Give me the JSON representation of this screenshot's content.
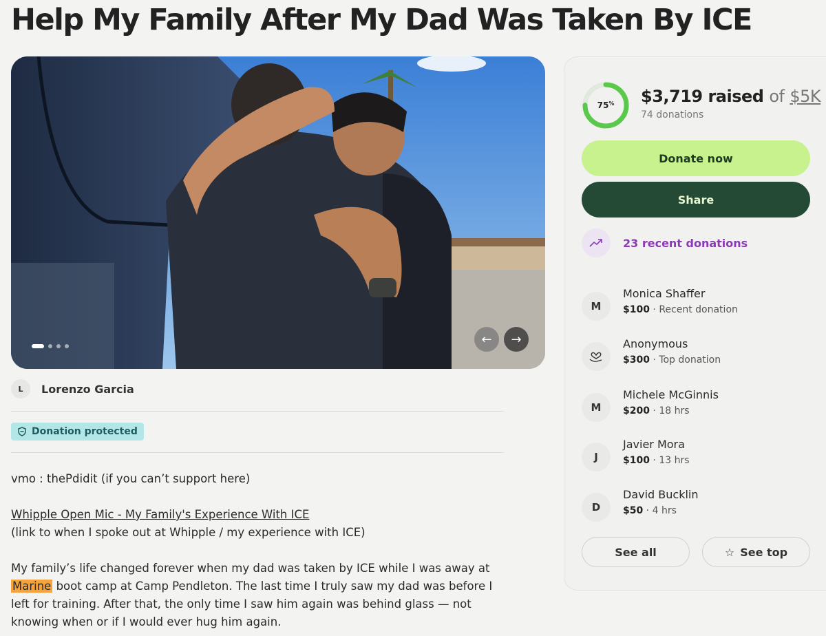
{
  "page": {
    "title": "Help My Family After My Dad Was Taken By ICE"
  },
  "carousel": {
    "slide_count": 4,
    "active_index": 0,
    "prev_icon": "arrow-left-icon",
    "next_icon": "arrow-right-icon"
  },
  "organizer": {
    "initial": "L",
    "name": "Lorenzo Garcia"
  },
  "badge": {
    "label": "Donation protected",
    "icon": "shield-icon"
  },
  "story": {
    "venmo_line": "vmo : thePdidit (if you can’t support here)",
    "link_text": "Whipple Open Mic - My Family's Experience With ICE",
    "link_note": "(link to when I spoke out at Whipple / my experience with ICE)",
    "p1_before": "My family’s life changed forever when my dad was taken by ICE while I was away at ",
    "p1_highlight": "Marine",
    "p1_after": " boot camp at Camp Pendleton. The last time I truly saw my dad was before I left for training. After that, the only time I saw him again was behind glass — not knowing when or if I would ever hug him again."
  },
  "progress": {
    "percent": 75,
    "percent_label": "75",
    "percent_sign": "%",
    "raised": "$3,719 raised",
    "of": "of",
    "goal": "$5K",
    "donations": "74 donations"
  },
  "actions": {
    "donate_label": "Donate now",
    "share_label": "Share"
  },
  "recent": {
    "label": "23 recent donations",
    "icon": "trending-up-icon"
  },
  "donors": [
    {
      "initial": "M",
      "name": "Monica Shaffer",
      "amount": "$100",
      "note": " · Recent donation"
    },
    {
      "initial": "",
      "icon": "heart-hand-icon",
      "name": "Anonymous",
      "amount": "$300",
      "note": " · Top donation"
    },
    {
      "initial": "M",
      "name": "Michele McGinnis",
      "amount": "$200",
      "note": " · 18 hrs"
    },
    {
      "initial": "J",
      "name": "Javier Mora",
      "amount": "$100",
      "note": " · 13 hrs"
    },
    {
      "initial": "D",
      "name": "David Bucklin",
      "amount": "$50",
      "note": " · 4 hrs"
    }
  ],
  "footer_buttons": {
    "see_all": "See all",
    "see_top": "See top",
    "star_icon": "star-icon"
  },
  "colors": {
    "progress_green": "#5ac84a",
    "donate_bg": "#c7f28d",
    "share_bg": "#244a36",
    "recent_purple": "#8a3ab5",
    "highlight": "#f6a33c"
  }
}
